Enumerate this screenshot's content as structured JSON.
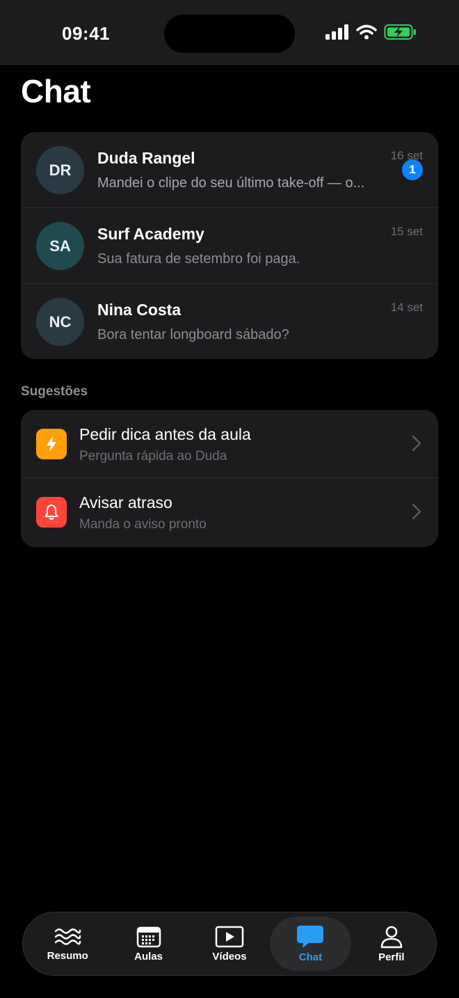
{
  "status": {
    "time": "09:41"
  },
  "title": "Chat",
  "chats": [
    {
      "initials": "DR",
      "name": "Duda Rangel",
      "date": "16 set",
      "preview": "Mandei o clipe do seu último take-off — o...",
      "unread": "1"
    },
    {
      "initials": "SA",
      "name": "Surf Academy",
      "date": "15 set",
      "preview": "Sua fatura de setembro foi paga."
    },
    {
      "initials": "NC",
      "name": "Nina Costa",
      "date": "14 set",
      "preview": "Bora tentar longboard sábado?"
    }
  ],
  "suggestions": {
    "label": "Sugestões",
    "items": [
      {
        "title": "Pedir dica antes da aula",
        "subtitle": "Pergunta rápida ao Duda",
        "icon": "bolt-icon",
        "color": "#ff9f0a"
      },
      {
        "title": "Avisar atraso",
        "subtitle": "Manda o aviso pronto",
        "icon": "bell-icon",
        "color": "#ff453a"
      }
    ]
  },
  "tabs": [
    {
      "label": "Resumo",
      "icon": "waves-icon"
    },
    {
      "label": "Aulas",
      "icon": "calendar-icon"
    },
    {
      "label": "Vídeos",
      "icon": "play-icon"
    },
    {
      "label": "Chat",
      "icon": "chat-bubble-icon",
      "active": true
    },
    {
      "label": "Perfil",
      "icon": "person-icon"
    }
  ],
  "colors": {
    "accent": "#2a9df4",
    "badge": "#0a84ff",
    "battery": "#30d158"
  }
}
